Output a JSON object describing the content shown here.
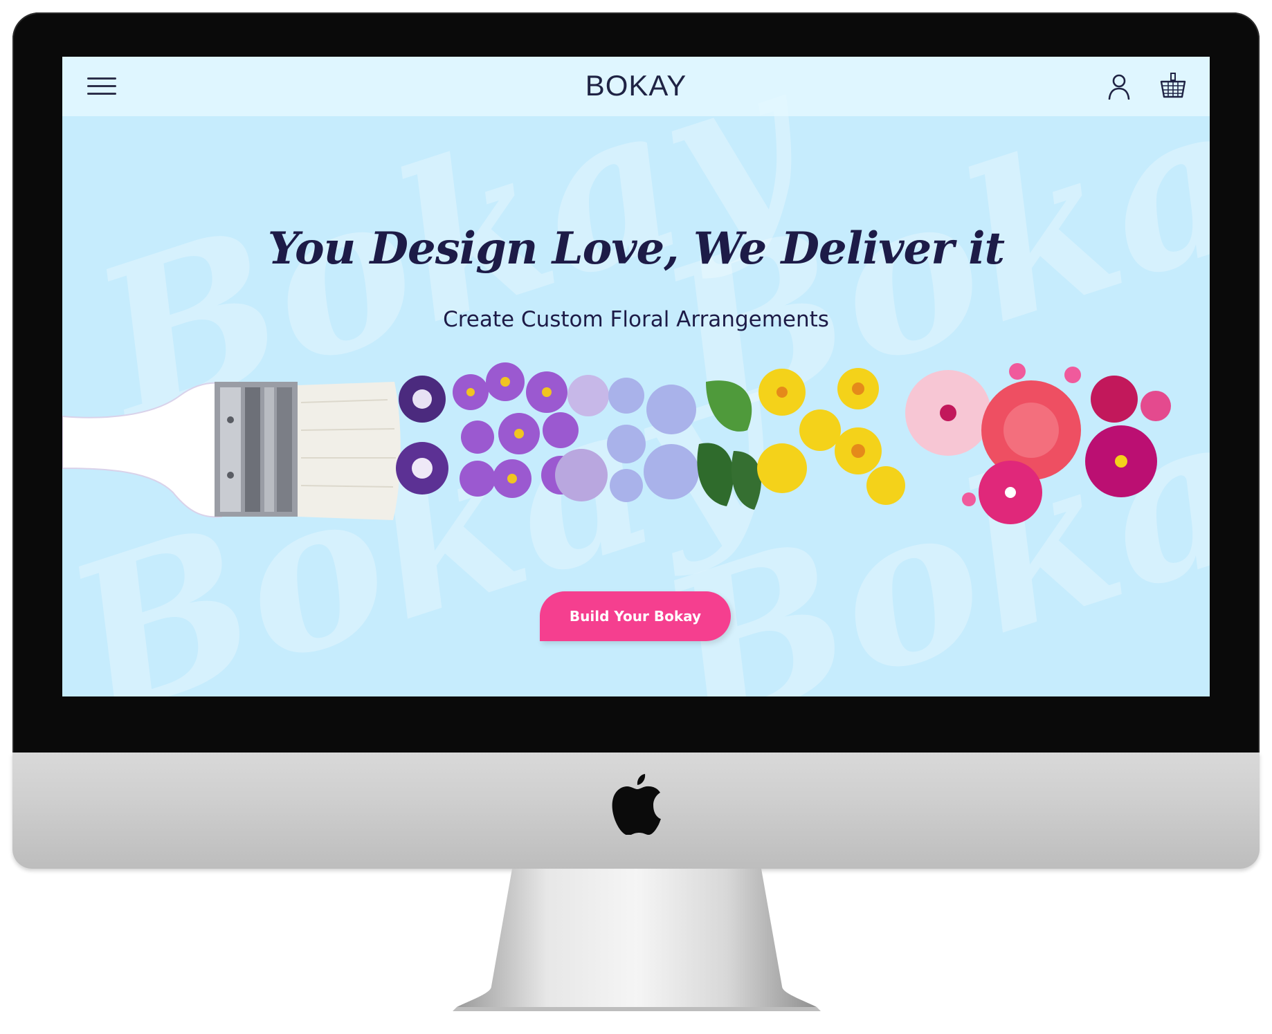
{
  "header": {
    "logo": "BOKAY",
    "menu_icon": "hamburger-menu-icon",
    "account_icon": "user-icon",
    "cart_icon": "basket-icon"
  },
  "hero": {
    "headline": "You Design Love, We Deliver it",
    "subheadline": "Create Custom Floral Arrangements",
    "cta_label": "Build Your Bokay",
    "background_watermark": "Bokay"
  },
  "colors": {
    "background": "#c6ecfd",
    "headline": "#1d1b47",
    "cta": "#f53f8f",
    "header_bar": "#e6f8ff"
  },
  "image": {
    "description_icon": "paintbrush-flowers-image"
  }
}
